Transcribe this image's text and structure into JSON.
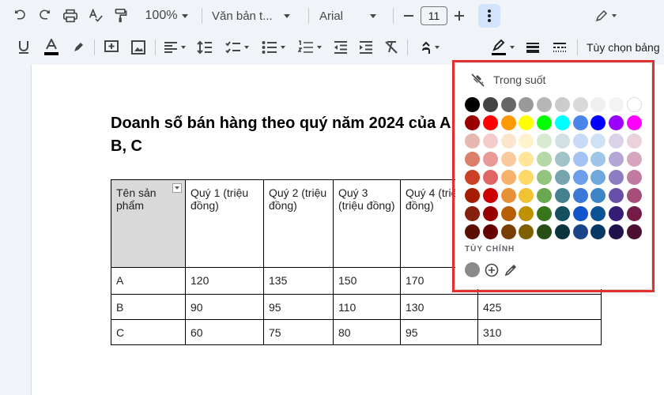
{
  "toolbar": {
    "zoom": "100%",
    "style": "Văn bản t...",
    "font": "Arial",
    "font_size": "11",
    "table_options": "Tùy chọn bảng"
  },
  "document": {
    "title": "Doanh số bán hàng theo quý năm 2024 của A, B, C",
    "table": {
      "headers": [
        "Tên sản phẩm",
        "Quý 1 (triệu đồng)",
        "Quý 2 (triệu đồng)",
        "Quý 3 (triệu đồng)",
        "Quý 4 (triệu đồng)",
        ""
      ],
      "rows": [
        [
          "A",
          "120",
          "135",
          "150",
          "170",
          ""
        ],
        [
          "B",
          "90",
          "95",
          "110",
          "130",
          "425"
        ],
        [
          "C",
          "60",
          "75",
          "80",
          "95",
          "310"
        ]
      ]
    }
  },
  "palette": {
    "transparent_label": "Trong suốt",
    "custom_label": "TÙY CHỈNH",
    "rows": [
      [
        "#000000",
        "#434343",
        "#666666",
        "#999999",
        "#b7b7b7",
        "#cccccc",
        "#d9d9d9",
        "#efefef",
        "#f3f3f3",
        "#ffffff"
      ],
      [
        "#980000",
        "#ff0000",
        "#ff9900",
        "#ffff00",
        "#00ff00",
        "#00ffff",
        "#4a86e8",
        "#0000ff",
        "#9900ff",
        "#ff00ff"
      ],
      [
        "#e6b8af",
        "#f4cccc",
        "#fce5cd",
        "#fff2cc",
        "#d9ead3",
        "#d0e0e3",
        "#c9daf8",
        "#cfe2f3",
        "#d9d2e9",
        "#ead1dc"
      ],
      [
        "#dd7e6b",
        "#ea9999",
        "#f9cb9c",
        "#ffe599",
        "#b6d7a8",
        "#a2c4c9",
        "#a4c2f4",
        "#9fc5e8",
        "#b4a7d6",
        "#d5a6bd"
      ],
      [
        "#cc4125",
        "#e06666",
        "#f6b26b",
        "#ffd966",
        "#93c47d",
        "#76a5af",
        "#6d9eeb",
        "#6fa8dc",
        "#8e7cc3",
        "#c27ba0"
      ],
      [
        "#a61c00",
        "#cc0000",
        "#e69138",
        "#f1c232",
        "#6aa84f",
        "#45818e",
        "#3c78d8",
        "#3d85c6",
        "#674ea7",
        "#a64d79"
      ],
      [
        "#85200c",
        "#990000",
        "#b45f06",
        "#bf9000",
        "#38761d",
        "#134f5c",
        "#1155cc",
        "#0b5394",
        "#351c75",
        "#741b47"
      ],
      [
        "#5b0f00",
        "#660000",
        "#783f04",
        "#7f6000",
        "#274e13",
        "#0c343d",
        "#1c4587",
        "#073763",
        "#20124d",
        "#4c1130"
      ]
    ],
    "custom_color": "#8a8a8a",
    "frame_color": "#e03030"
  }
}
